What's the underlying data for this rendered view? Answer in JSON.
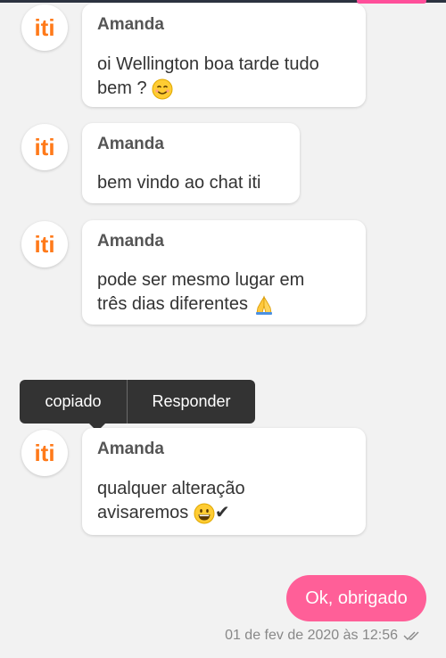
{
  "sender_name": "Amanda",
  "avatar_text": "iti",
  "messages": [
    {
      "lines": [
        "oi Wellington boa tarde tudo",
        "bem ?"
      ],
      "emoji": "smiling-face-icon"
    },
    {
      "lines": [
        "bem vindo ao chat iti"
      ]
    },
    {
      "lines": [
        "pode ser mesmo lugar em",
        "três dias diferentes"
      ],
      "emoji": "folded-hands-icon"
    },
    {
      "lines": [
        "qualquer alteração",
        "avisaremos"
      ],
      "emoji": "grinning-face-icon",
      "suffix": "✔"
    }
  ],
  "context_menu": {
    "copy_label": "copiado",
    "reply_label": "Responder"
  },
  "outgoing": {
    "text": "Ok, obrigado"
  },
  "timestamp": "01 de fev de 2020 às 12:56",
  "colors": {
    "brand_orange": "#ff7a1a",
    "brand_pink": "#ff5f98",
    "tooltip_bg": "#333333"
  }
}
